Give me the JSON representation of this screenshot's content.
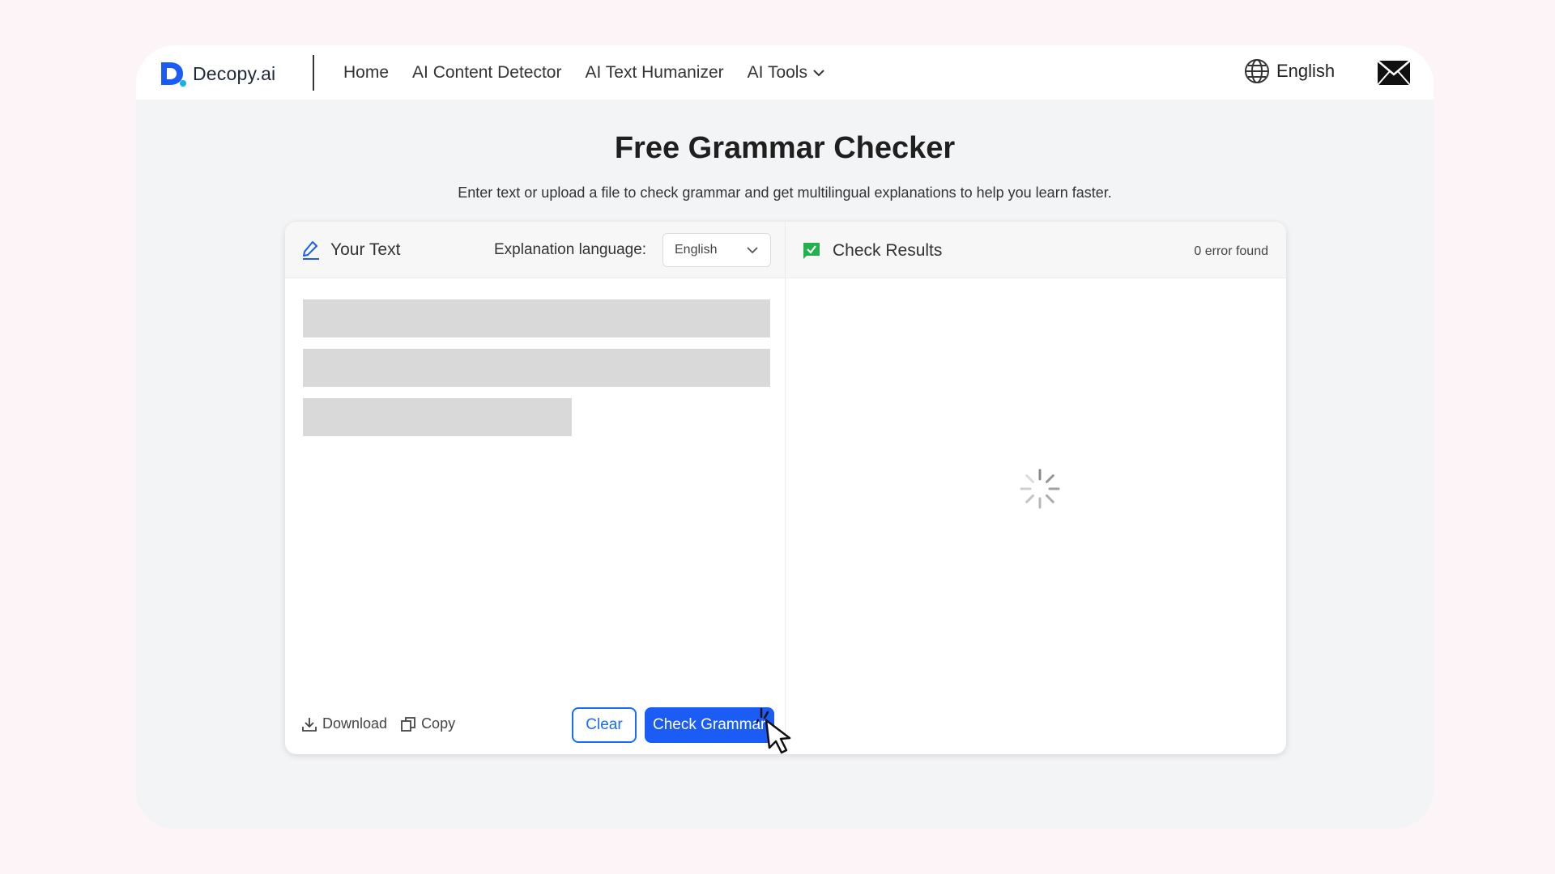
{
  "navbar": {
    "logo_text": "Decopy.ai",
    "links": [
      "Home",
      "AI Content Detector",
      "AI Text Humanizer",
      "AI Tools"
    ],
    "language": "English"
  },
  "main": {
    "title": "Free Grammar Checker",
    "subtitle": "Enter text or upload a file to check grammar and get multilingual explanations to help you learn faster."
  },
  "editor": {
    "header_label": "Your Text",
    "explanation_label": "Explanation  language:",
    "explanation_language": "English",
    "download_label": "Download",
    "copy_label": "Copy",
    "clear_label": "Clear",
    "check_label": "Check Grammar"
  },
  "results": {
    "header_label": "Check Results",
    "error_count": "0 error found",
    "status": "loading"
  },
  "colors": {
    "accent": "#1a5cf5",
    "check_icon": "#22b14c",
    "background": "#fdf4f8"
  },
  "icons": {
    "logo": "decopy-logo-icon",
    "nav_dropdown": "chevron-down-icon",
    "language": "globe-icon",
    "mail": "mail-icon",
    "editor": "pen-icon",
    "results": "check-flag-icon",
    "select": "chevron-down-icon",
    "download": "download-icon",
    "copy": "copy-icon",
    "loading": "spinner-icon",
    "cursor": "cursor-icon"
  }
}
